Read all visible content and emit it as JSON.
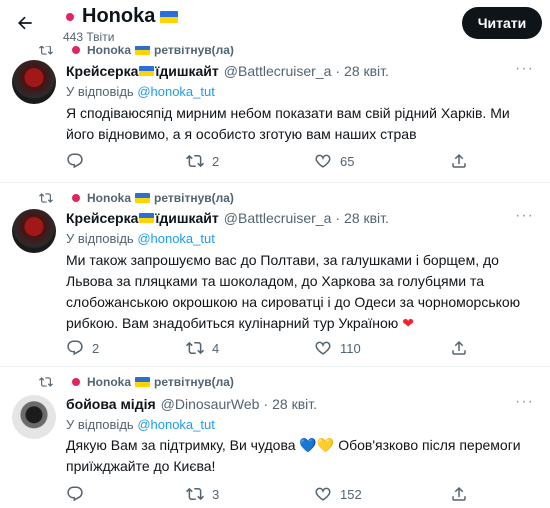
{
  "header": {
    "title": "Honoka",
    "subtitle": "443 Твіти",
    "read_button": "Читати"
  },
  "retweet_by": "Honoka",
  "retweet_suffix": "ретвітнув(ла)",
  "reply_prefix": "У відповідь",
  "tweets": [
    {
      "name_prefix": "Крейсерка",
      "name_suffix": "їдишкайт",
      "handle": "@Battlecruiser_a",
      "date": "28 квіт.",
      "reply_to": "@honoka_tut",
      "text": "Я сподіваюсяпід мирним небом показати вам свій рідний Харків. Ми його відновимо, а я особисто зготую вам наших страв",
      "replies": "",
      "retweets": "2",
      "likes": "65"
    },
    {
      "name_prefix": "Крейсерка",
      "name_suffix": "їдишкайт",
      "handle": "@Battlecruiser_a",
      "date": "28 квіт.",
      "reply_to": "@honoka_tut",
      "text": "Ми також запрошуємо вас до Полтави, за галушками і борщем, до Львова за пляцками та шоколадом, до Харкова за голубцями та слобожанською окрошкою на сироватці і до Одеси за чорноморською рибкою. Вам знадобиться кулінарний тур Україною",
      "emoji": "❤",
      "replies": "2",
      "retweets": "4",
      "likes": "110"
    },
    {
      "name": "бойова мідія",
      "handle": "@DinosaurWeb",
      "date": "28 квіт.",
      "reply_to": "@honoka_tut",
      "text_line1": "Дякую Вам за підтримку, Ви чудова",
      "emoji": "💙💛",
      "text_line1_end": "Обов'язково після перемоги",
      "text_line2": "приїжджайте до Києва!",
      "replies": "",
      "retweets": "3",
      "likes": "152"
    }
  ],
  "colors": {
    "link": "#1d9bf0",
    "muted": "#536471",
    "heart": "#f4212e",
    "text": "#0f1419"
  }
}
